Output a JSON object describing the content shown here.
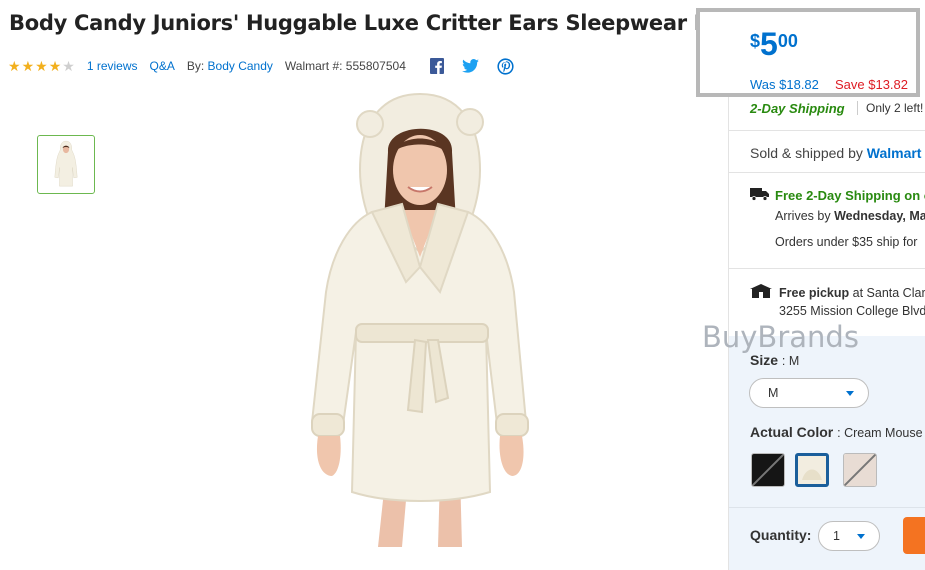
{
  "product": {
    "title": "Body Candy Juniors' Huggable Luxe Critter Ears Sleepwear Robe",
    "rating": 4,
    "reviews_link": "1 reviews",
    "qa_link": "Q&A",
    "by_label": "By:",
    "brand": "Body Candy",
    "sku_label": "Walmart #: 555807504"
  },
  "social": {
    "icons": [
      "facebook-icon",
      "twitter-icon",
      "pinterest-icon"
    ],
    "colors": {
      "facebook": "#3b5998",
      "twitter": "#1da1f2",
      "pinterest": "#0071ce"
    }
  },
  "price": {
    "currency": "$",
    "dollars": "5",
    "cents": "00",
    "was": "Was $18.82",
    "save": "Save $13.82"
  },
  "shipping": {
    "two_day": "2-Day Shipping",
    "stock": "Only 2 left!",
    "sold_prefix": "Sold & shipped by",
    "seller": "Walmart",
    "free_shipping": "Free 2-Day Shipping on o",
    "arrives_prefix": "Arrives by",
    "arrives_day": "Wednesday, Ma",
    "orders_note": "Orders under $35 ship for",
    "pickup_bold": "Free pickup",
    "pickup_rest": " at Santa Clar",
    "address": "3255 Mission College Blvd"
  },
  "watermark": "BuyBrands",
  "options": {
    "size_label": "Size",
    "size_value": ": M",
    "size_selected": "M",
    "color_label": "Actual Color",
    "color_value": ": Cream Mouse",
    "swatches": [
      "#151515",
      "#f2ede0",
      "#e8dcd4"
    ],
    "quantity_label": "Quantity:",
    "quantity_value": "1"
  },
  "colors": {
    "accent": "#0071ce",
    "sale": "#de1c24",
    "shipping_green": "#298a10",
    "rating_star": "#f2b01e",
    "add_button": "#f47321"
  }
}
